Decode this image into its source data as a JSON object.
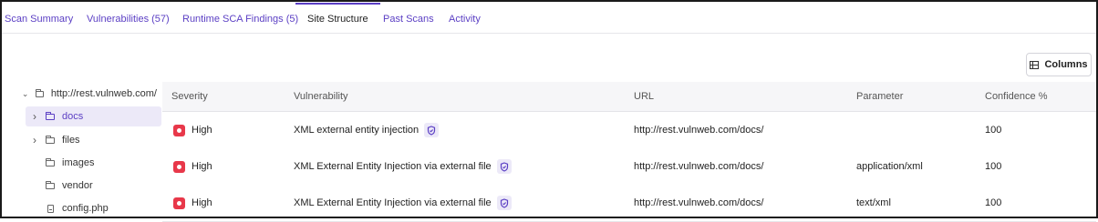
{
  "tabs": [
    {
      "label": "Scan Summary",
      "active": false
    },
    {
      "label": "Vulnerabilities (57)",
      "active": false
    },
    {
      "label": "Runtime SCA Findings (5)",
      "active": false
    },
    {
      "label": "Site Structure",
      "active": true
    },
    {
      "label": "Past Scans",
      "active": false
    },
    {
      "label": "Activity",
      "active": false
    }
  ],
  "toolbar": {
    "columns_label": "Columns"
  },
  "tree": {
    "root": {
      "label": "http://rest.vulnweb.com/",
      "expanded": true
    },
    "items": [
      {
        "label": "docs",
        "type": "folder",
        "expandable": true,
        "selected": true
      },
      {
        "label": "files",
        "type": "folder",
        "expandable": true,
        "selected": false
      },
      {
        "label": "images",
        "type": "folder",
        "expandable": false,
        "selected": false
      },
      {
        "label": "vendor",
        "type": "folder",
        "expandable": false,
        "selected": false
      },
      {
        "label": "config.php",
        "type": "file",
        "expandable": false,
        "selected": false
      }
    ]
  },
  "table": {
    "columns": [
      "Severity",
      "Vulnerability",
      "URL",
      "Parameter",
      "Confidence %"
    ],
    "rows": [
      {
        "severity": "High",
        "vulnerability": "XML external entity injection",
        "url": "http://rest.vulnweb.com/docs/",
        "parameter": "",
        "confidence": "100"
      },
      {
        "severity": "High",
        "vulnerability": "XML External Entity Injection via external file",
        "url": "http://rest.vulnweb.com/docs/",
        "parameter": "application/xml",
        "confidence": "100"
      },
      {
        "severity": "High",
        "vulnerability": "XML External Entity Injection via external file",
        "url": "http://rest.vulnweb.com/docs/",
        "parameter": "text/xml",
        "confidence": "100"
      }
    ]
  },
  "colors": {
    "accent": "#5b3fc4",
    "severity_high": "#e8384a",
    "selected_bg": "#ece9f8"
  },
  "icons": {
    "columns": "columns-icon",
    "folder": "folder-icon",
    "file": "file-icon",
    "severity": "severity-high-icon",
    "verified": "shield-icon"
  }
}
